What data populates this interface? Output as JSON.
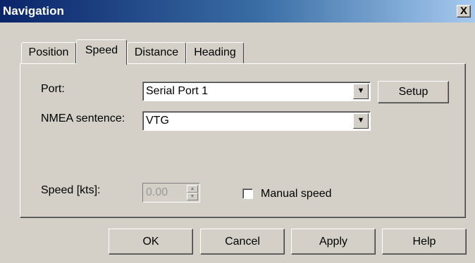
{
  "window": {
    "title": "Navigation",
    "close_label": "X"
  },
  "tabs": [
    {
      "label": "Position",
      "active": false
    },
    {
      "label": "Speed",
      "active": true
    },
    {
      "label": "Distance",
      "active": false
    },
    {
      "label": "Heading",
      "active": false
    }
  ],
  "form": {
    "port_label": "Port:",
    "port_value": "Serial Port 1",
    "setup_label": "Setup",
    "nmea_label": "NMEA sentence:",
    "nmea_value": "VTG",
    "speed_label": "Speed [kts]:",
    "speed_value": "0.00",
    "manual_speed_label": "Manual speed",
    "manual_speed_checked": false
  },
  "buttons": {
    "ok": "OK",
    "cancel": "Cancel",
    "apply": "Apply",
    "help": "Help"
  },
  "icons": {
    "dropdown": "chevron-down-icon",
    "spin_up": "spin-up-icon",
    "spin_down": "spin-down-icon",
    "close": "close-icon"
  }
}
